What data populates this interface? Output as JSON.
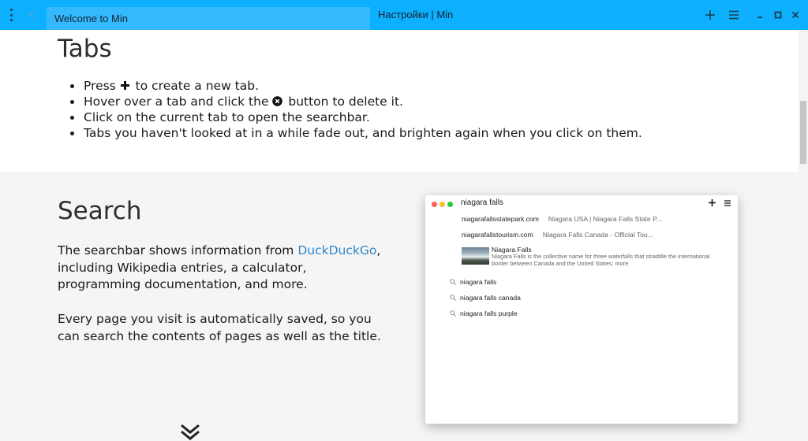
{
  "titlebar": {
    "menu_icon": "vertical-dots-icon",
    "back_icon": "chevron-left-icon",
    "tabs": [
      {
        "label": "Welcome to Min",
        "active": true
      },
      {
        "label": "Настройки | Min",
        "active": false
      }
    ],
    "buttons": [
      "plus-icon",
      "hamburger-icon",
      "minimize-icon",
      "maximize-icon",
      "close-icon"
    ],
    "color": "#0dafff"
  },
  "tabs_section": {
    "heading": "Tabs",
    "tips": [
      {
        "before": "Press ",
        "icon": "plus-icon",
        "after": " to create a new tab."
      },
      {
        "before": "Hover over a tab and click the ",
        "icon": "close-circle-icon",
        "after": " button to delete it."
      },
      {
        "before": "Click on the current tab to open the searchbar.",
        "icon": null,
        "after": ""
      },
      {
        "before": "Tabs you haven't looked at in a while fade out, and brighten again when you click on them.",
        "icon": null,
        "after": ""
      }
    ]
  },
  "search_section": {
    "heading": "Search",
    "para1_before": "The searchbar shows information from ",
    "para1_link": "DuckDuckGo",
    "para1_after": ", including Wikipedia entries, a calculator, programming documentation, and more.",
    "para2": "Every page you visit is automatically saved, so you can search the contents of pages as well as the title.",
    "link_color": "#2f86c9",
    "scroll_icon": "double-chevron-down-icon"
  },
  "preview": {
    "query": "niagara falls",
    "results": [
      {
        "url": "niagarafallsstatepark.com",
        "title": "Niagara USA | Niagara Falls State P..."
      },
      {
        "url": "niagarafallstourism.com",
        "title": "Niagara Falls Canada - Official Tou..."
      }
    ],
    "wiki": {
      "title": "Niagara Falls",
      "desc": "Niagara Falls is the collective name for three waterfalls that straddle the international border between Canada and the United States; more"
    },
    "suggestions": [
      "niagara falls",
      "niagara falls canada",
      "niagara falls purple"
    ],
    "traffic_colors": [
      "#ff5f57",
      "#ffbd2e",
      "#28c940"
    ]
  }
}
